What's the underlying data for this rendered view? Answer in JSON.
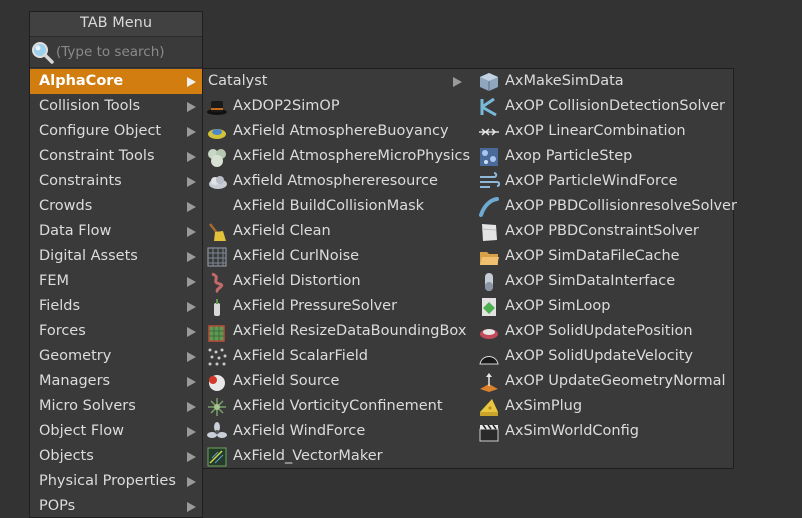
{
  "menu": {
    "title": "TAB Menu",
    "search_placeholder": "(Type to search)",
    "categories": [
      "AlphaCore",
      "Collision Tools",
      "Configure Object",
      "Constraint Tools",
      "Constraints",
      "Crowds",
      "Data Flow",
      "Digital Assets",
      "FEM",
      "Fields",
      "Forces",
      "Geometry",
      "Managers",
      "Micro Solvers",
      "Object Flow",
      "Objects",
      "Physical Properties",
      "POPs"
    ],
    "active_category": "AlphaCore"
  },
  "submenu": {
    "column1": [
      {
        "label": "Catalyst",
        "icon": "none",
        "has_submenu": true
      },
      {
        "label": "AxDOP2SimOP",
        "icon": "top-hat-icon"
      },
      {
        "label": "AxField AtmosphereBuoyancy",
        "icon": "buoyancy-icon"
      },
      {
        "label": "AxField AtmosphereMicroPhysics",
        "icon": "microphysics-icon"
      },
      {
        "label": "Axfield Atmosphereresource",
        "icon": "cloud-icon"
      },
      {
        "label": "AxField BuildCollisionMask",
        "icon": "none"
      },
      {
        "label": "AxField Clean",
        "icon": "broom-icon"
      },
      {
        "label": "AxField CurlNoise",
        "icon": "noise-grid-icon"
      },
      {
        "label": "AxField Distortion",
        "icon": "distortion-icon"
      },
      {
        "label": "AxField PressureSolver",
        "icon": "pressure-icon"
      },
      {
        "label": "AxField ResizeDataBoundingBox",
        "icon": "bounding-box-icon"
      },
      {
        "label": "AxField ScalarField",
        "icon": "scalar-dots-icon"
      },
      {
        "label": "AxField Source",
        "icon": "source-icon"
      },
      {
        "label": "AxField VorticityConfinement",
        "icon": "vorticity-icon"
      },
      {
        "label": "AxField WindForce",
        "icon": "fan-icon"
      },
      {
        "label": "AxField_VectorMaker",
        "icon": "vector-maker-icon"
      }
    ],
    "column2": [
      {
        "label": "AxMakeSimData",
        "icon": "cube-data-icon"
      },
      {
        "label": "AxOP CollisionDetectionSolver",
        "icon": "collision-icon"
      },
      {
        "label": "AxOP LinearCombination",
        "icon": "linear-combination-icon"
      },
      {
        "label": "Axop ParticleStep",
        "icon": "particle-step-icon"
      },
      {
        "label": "AxOP ParticleWindForce",
        "icon": "wind-icon"
      },
      {
        "label": "AxOP PBDCollisionresolveSolver",
        "icon": "pbd-collision-icon"
      },
      {
        "label": "AxOP PBDConstraintSolver",
        "icon": "cloth-icon"
      },
      {
        "label": "AxOP SimDataFileCache",
        "icon": "folder-icon"
      },
      {
        "label": "AxOP SimDataInterface",
        "icon": "capsule-icon"
      },
      {
        "label": "AxOP SimLoop",
        "icon": "sim-loop-icon"
      },
      {
        "label": "AxOP SolidUpdatePosition",
        "icon": "solid-position-icon"
      },
      {
        "label": "AxOP SolidUpdateVelocity",
        "icon": "solid-velocity-icon"
      },
      {
        "label": "AxOP UpdateGeometryNormal",
        "icon": "normal-icon"
      },
      {
        "label": "AxSimPlug",
        "icon": "cheese-icon"
      },
      {
        "label": "AxSimWorldConfig",
        "icon": "clapper-icon"
      }
    ]
  },
  "colors": {
    "background": "#333333",
    "menu": "#3a3a3a",
    "active": "#d17d0f",
    "text": "#dcdcdc"
  }
}
